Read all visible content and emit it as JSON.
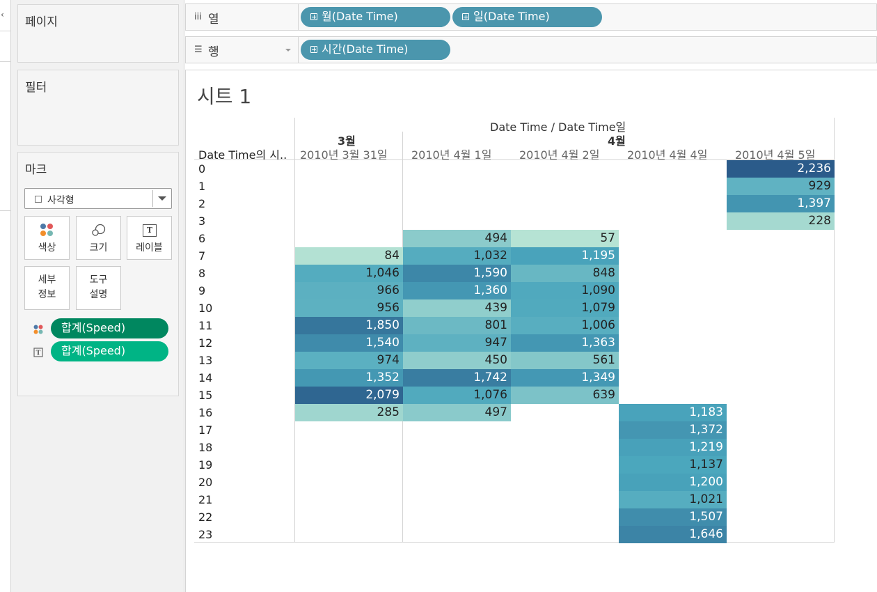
{
  "colors": {
    "shelf_pill": "#4b96ad",
    "measure_pill_color": "#00875f",
    "measure_pill_label": "#00b485"
  },
  "left_panel": {
    "pages_title": "페이지",
    "filters_title": "필터",
    "marks_title": "마크",
    "mark_type": "사각형",
    "buttons": {
      "color": "색상",
      "size": "크기",
      "label": "레이블",
      "detail": "세부\n정보",
      "tooltip": "도구\n설명"
    },
    "mark_pills": [
      {
        "icon": "color-dots-icon",
        "label": "합계(Speed)"
      },
      {
        "icon": "text-label-icon",
        "label": "합계(Speed)"
      }
    ]
  },
  "shelves": {
    "columns_label": "열",
    "columns_pills": [
      "월(Date Time)",
      "일(Date Time)"
    ],
    "rows_label": "행",
    "rows_pills": [
      "시간(Date Time)"
    ]
  },
  "view": {
    "title": "시트 1",
    "column_header_top": "Date Time / Date Time일",
    "months": [
      "3월",
      "4월"
    ],
    "row_header_label": "Date Time의 시..",
    "dates": [
      "2010년 3월 31일",
      "2010년 4월 1일",
      "2010년 4월 2일",
      "2010년 4월 4일",
      "2010년 4월 5일"
    ],
    "hours": [
      "0",
      "1",
      "2",
      "3",
      "6",
      "7",
      "8",
      "9",
      "10",
      "11",
      "12",
      "13",
      "14",
      "15",
      "16",
      "17",
      "18",
      "19",
      "20",
      "21",
      "22",
      "23"
    ]
  },
  "chart_data": {
    "type": "heatmap",
    "title": "시트 1",
    "x_header": "Date Time / Date Time일",
    "y_header": "Date Time의 시..",
    "columns": [
      "2010년 3월 31일",
      "2010년 4월 1일",
      "2010년 4월 2일",
      "2010년 4월 4일",
      "2010년 4월 5일"
    ],
    "rows": [
      "0",
      "1",
      "2",
      "3",
      "6",
      "7",
      "8",
      "9",
      "10",
      "11",
      "12",
      "13",
      "14",
      "15",
      "16",
      "17",
      "18",
      "19",
      "20",
      "21",
      "22",
      "23"
    ],
    "values": [
      [
        null,
        null,
        null,
        null,
        2236
      ],
      [
        null,
        null,
        null,
        null,
        929
      ],
      [
        null,
        null,
        null,
        null,
        1397
      ],
      [
        null,
        null,
        null,
        null,
        228
      ],
      [
        null,
        494,
        57,
        null,
        null
      ],
      [
        84,
        1032,
        1195,
        null,
        null
      ],
      [
        1046,
        1590,
        848,
        null,
        null
      ],
      [
        966,
        1360,
        1090,
        null,
        null
      ],
      [
        956,
        439,
        1079,
        null,
        null
      ],
      [
        1850,
        801,
        1006,
        null,
        null
      ],
      [
        1540,
        947,
        1363,
        null,
        null
      ],
      [
        974,
        450,
        561,
        null,
        null
      ],
      [
        1352,
        1742,
        1349,
        null,
        null
      ],
      [
        2079,
        1076,
        639,
        null,
        null
      ],
      [
        285,
        497,
        null,
        1183,
        null
      ],
      [
        null,
        null,
        null,
        1372,
        null
      ],
      [
        null,
        null,
        null,
        1219,
        null
      ],
      [
        null,
        null,
        null,
        1137,
        null
      ],
      [
        null,
        null,
        null,
        1200,
        null
      ],
      [
        null,
        null,
        null,
        1021,
        null
      ],
      [
        null,
        null,
        null,
        1507,
        null
      ],
      [
        null,
        null,
        null,
        1646,
        null
      ]
    ],
    "measure": "합계(Speed)",
    "color_scale": [
      "#b6e3d4",
      "#2b5b8a"
    ]
  }
}
